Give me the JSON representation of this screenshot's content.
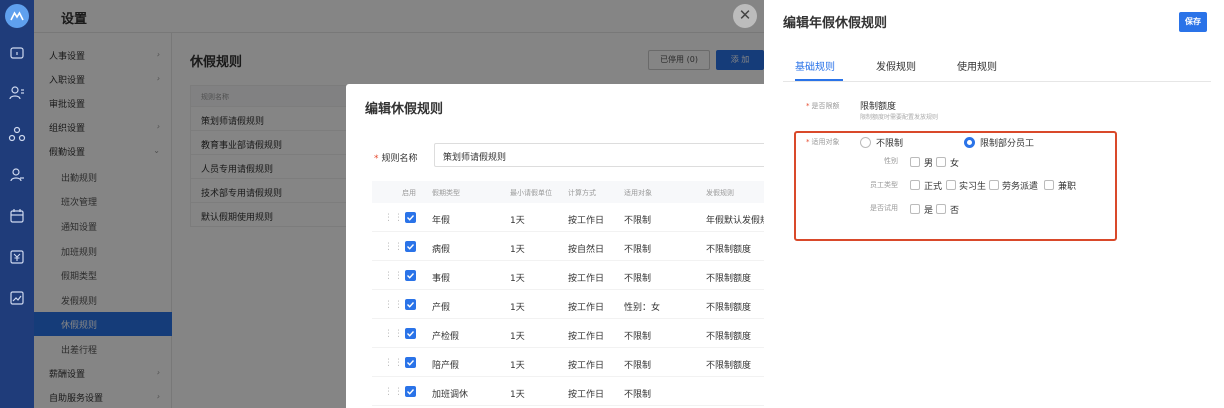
{
  "header": {
    "title": "设置"
  },
  "rail_icons": [
    "logo-icon",
    "home-icon",
    "people-icon",
    "org-icon",
    "user-icon",
    "calendar-icon",
    "salary-icon",
    "report-icon"
  ],
  "sidebar": {
    "items": [
      {
        "label": "人事设置",
        "chevron": "›"
      },
      {
        "label": "入职设置",
        "chevron": "›"
      },
      {
        "label": "审批设置",
        "chevron": ""
      },
      {
        "label": "组织设置",
        "chevron": "›"
      },
      {
        "label": "假勤设置",
        "chevron": "⌄"
      },
      {
        "label": "出勤规则",
        "sub": true
      },
      {
        "label": "班次管理",
        "sub": true
      },
      {
        "label": "通知设置",
        "sub": true
      },
      {
        "label": "加班规则",
        "sub": true
      },
      {
        "label": "假期类型",
        "sub": true
      },
      {
        "label": "发假规则",
        "sub": true
      },
      {
        "label": "休假规则",
        "sub": true,
        "active": true
      },
      {
        "label": "出差行程",
        "sub": true
      },
      {
        "label": "薪酬设置",
        "chevron": "›"
      },
      {
        "label": "自助服务设置",
        "chevron": "›"
      }
    ]
  },
  "main": {
    "title": "休假规则",
    "disabled_btn": "已停用 (0)",
    "add_btn": "添 加",
    "table": {
      "header": "规则名称",
      "rows": [
        "策划师请假规则",
        "教育事业部请假规则",
        "人员专用请假规则",
        "技术部专用请假规则",
        "默认假期使用规则"
      ]
    }
  },
  "modal": {
    "title": "编辑休假规则",
    "field_label": "规则名称",
    "field_required": "*",
    "field_value": "策划师请假规则",
    "columns": [
      "启用",
      "假期类型",
      "最小请假单位",
      "计算方式",
      "适用对象",
      "发假规则"
    ],
    "rows": [
      [
        "年假",
        "1天",
        "按工作日",
        "不限制",
        "年假默认发假规"
      ],
      [
        "病假",
        "1天",
        "按自然日",
        "不限制",
        "不限制额度"
      ],
      [
        "事假",
        "1天",
        "按工作日",
        "不限制",
        "不限制额度"
      ],
      [
        "产假",
        "1天",
        "按工作日",
        "性别：女",
        "不限制额度"
      ],
      [
        "产检假",
        "1天",
        "按工作日",
        "不限制",
        "不限制额度"
      ],
      [
        "陪产假",
        "1天",
        "按工作日",
        "不限制",
        "不限制额度"
      ],
      [
        "加班调休",
        "1天",
        "按工作日",
        "不限制",
        ""
      ]
    ],
    "drag_handle": "⋮⋮"
  },
  "drawer": {
    "close": "✕",
    "title": "编辑年假休假规则",
    "save": "保存",
    "tabs": [
      "基础规则",
      "发假规则",
      "使用规则"
    ],
    "limit_label": "是否限额",
    "limit_value": "限制额度",
    "limit_hint": "限制额度时需要配置发放规则",
    "scope_label": "适用对象",
    "required": "*",
    "scope_options": [
      "不限制",
      "限制部分员工"
    ],
    "gender_label": "性别",
    "gender_options": [
      "男",
      "女"
    ],
    "emptype_label": "员工类型",
    "emptype_options": [
      "正式",
      "实习生",
      "劳务派遣",
      "兼职"
    ],
    "probation_label": "是否试用",
    "probation_options": [
      "是",
      "否"
    ]
  },
  "colors": {
    "primary": "#2a73e8",
    "rail": "#1f3c7a",
    "highlight": "#d9492a",
    "required": "#e6492d"
  }
}
